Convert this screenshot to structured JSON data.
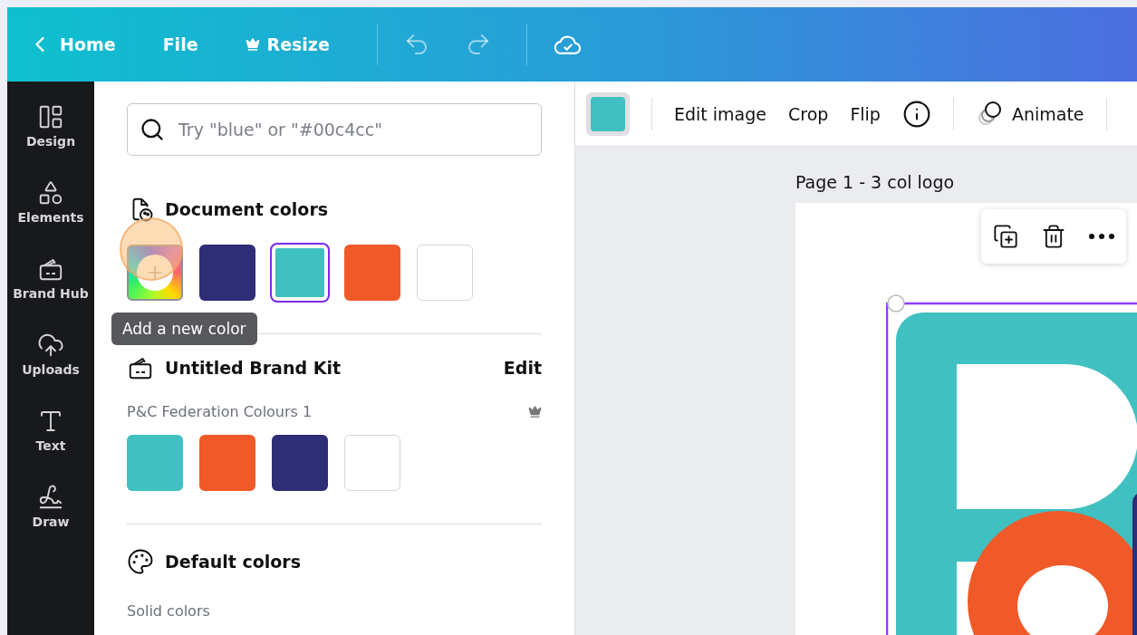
{
  "topbar": {
    "back": "Home",
    "menu": [
      {
        "label": "File",
        "kind": "plain"
      },
      {
        "label": "Resize",
        "kind": "premium"
      }
    ]
  },
  "sidebar": {
    "items": [
      {
        "label": "Design",
        "kind": "design"
      },
      {
        "label": "Elements",
        "kind": "elements"
      },
      {
        "label": "Brand Hub",
        "kind": "brand"
      },
      {
        "label": "Uploads",
        "kind": "uploads"
      },
      {
        "label": "Text",
        "kind": "text"
      },
      {
        "label": "Draw",
        "kind": "draw"
      }
    ]
  },
  "panel": {
    "search": {
      "placeholder": "Try \"blue\" or \"#00c4cc\""
    },
    "document_colors": {
      "title": "Document colors",
      "tooltip": "Add a new color",
      "swatches": [
        {
          "kind": "add",
          "selected": false
        },
        {
          "kind": "color",
          "color": "#2e2d76",
          "selected": false
        },
        {
          "kind": "color",
          "color": "#40c0c0",
          "selected": true
        },
        {
          "kind": "color",
          "color": "#f05a28",
          "selected": false
        },
        {
          "kind": "color",
          "color": "#ffffff",
          "selected": false
        }
      ]
    },
    "brand_kit": {
      "title": "Untitled Brand Kit",
      "edit": "Edit",
      "palette": "P&C Federation Colours 1",
      "swatches": [
        {
          "color": "#40c0c0"
        },
        {
          "color": "#f05a28"
        },
        {
          "color": "#2e2d76"
        },
        {
          "color": "#ffffff"
        }
      ]
    },
    "default_colors": {
      "title": "Default colors",
      "subtitle": "Solid colors"
    }
  },
  "toolbar": {
    "color": "#40c0c0",
    "items": [
      {
        "label": "Edit image"
      },
      {
        "label": "Crop"
      },
      {
        "label": "Flip"
      }
    ],
    "animate": "Animate"
  },
  "canvas": {
    "page_label": "Page 1 - 3 col logo"
  }
}
